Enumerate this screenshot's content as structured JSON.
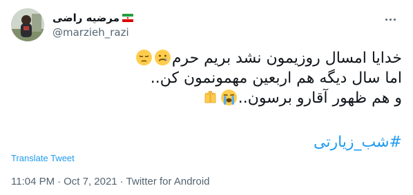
{
  "tweet": {
    "author": {
      "display_name": "مرضیه راضی",
      "handle": "@marzieh_razi"
    },
    "icons": {
      "avatar": "profile-photo",
      "flag": "iran-flag-emoji",
      "more": "more-options-icon",
      "emoji_1": "crying-face-emoji",
      "emoji_2": "pensive-face-emoji",
      "emoji_3": "loudly-crying-face-emoji",
      "emoji_4": "folded-hands-emoji"
    },
    "text": {
      "line1": "خدایا امسال روزیمون نشد بریم حرم",
      "line2": "اما سال دیگه هم اربعین مهمونمون کن..",
      "line3": "و هم ظهور آقارو برسون.."
    },
    "hashtag": "#شب_زیارتی",
    "translate_label": "Translate Tweet",
    "time": "11:04 PM",
    "date": "Oct 7, 2021",
    "separator": "·",
    "source": "Twitter for Android"
  },
  "colors": {
    "link": "#1d9bf0",
    "secondary_text": "#536471",
    "primary_text": "#0f1419"
  }
}
